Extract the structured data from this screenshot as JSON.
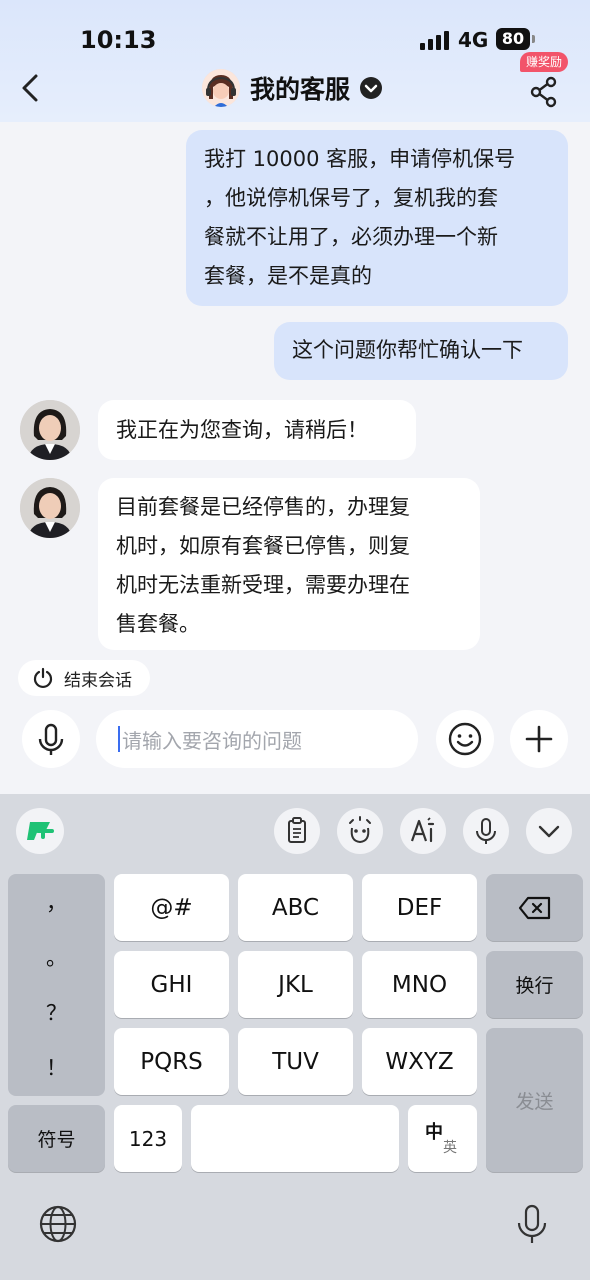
{
  "status_bar": {
    "time": "10:13",
    "network": "4G",
    "battery": "80"
  },
  "header": {
    "title": "我的客服",
    "reward_badge": "赚奖励"
  },
  "messages": [
    {
      "role": "user",
      "text_lines": [
        "我打 10000 客服，申请停机保号",
        "，他说停机保号了，复机我的套",
        "餐就不让用了，必须办理一个新",
        "套餐，是不是真的"
      ]
    },
    {
      "role": "user",
      "text_lines": [
        "这个问题你帮忙确认一下"
      ]
    },
    {
      "role": "agent",
      "text_lines": [
        "我正在为您查询，请稍后！"
      ]
    },
    {
      "role": "agent",
      "text_lines": [
        "目前套餐是已经停售的，办理复",
        "机时，如原有套餐已停售，则复",
        "机时无法重新受理，需要办理在",
        "售套餐。"
      ]
    }
  ],
  "end_chat": {
    "label": "结束会话"
  },
  "input": {
    "placeholder": "请输入要咨询的问题"
  },
  "keyboard": {
    "punctuation": [
      "，",
      "。",
      "？",
      "！"
    ],
    "rows": [
      [
        "@#",
        "ABC",
        "DEF"
      ],
      [
        "GHI",
        "JKL",
        "MNO"
      ],
      [
        "PQRS",
        "TUV",
        "WXYZ"
      ]
    ],
    "newline": "换行",
    "send": "发送",
    "symbols": "符号",
    "numbers": "123",
    "lang_top": "中",
    "lang_bottom": "英",
    "accent_color": "#1fc275"
  }
}
